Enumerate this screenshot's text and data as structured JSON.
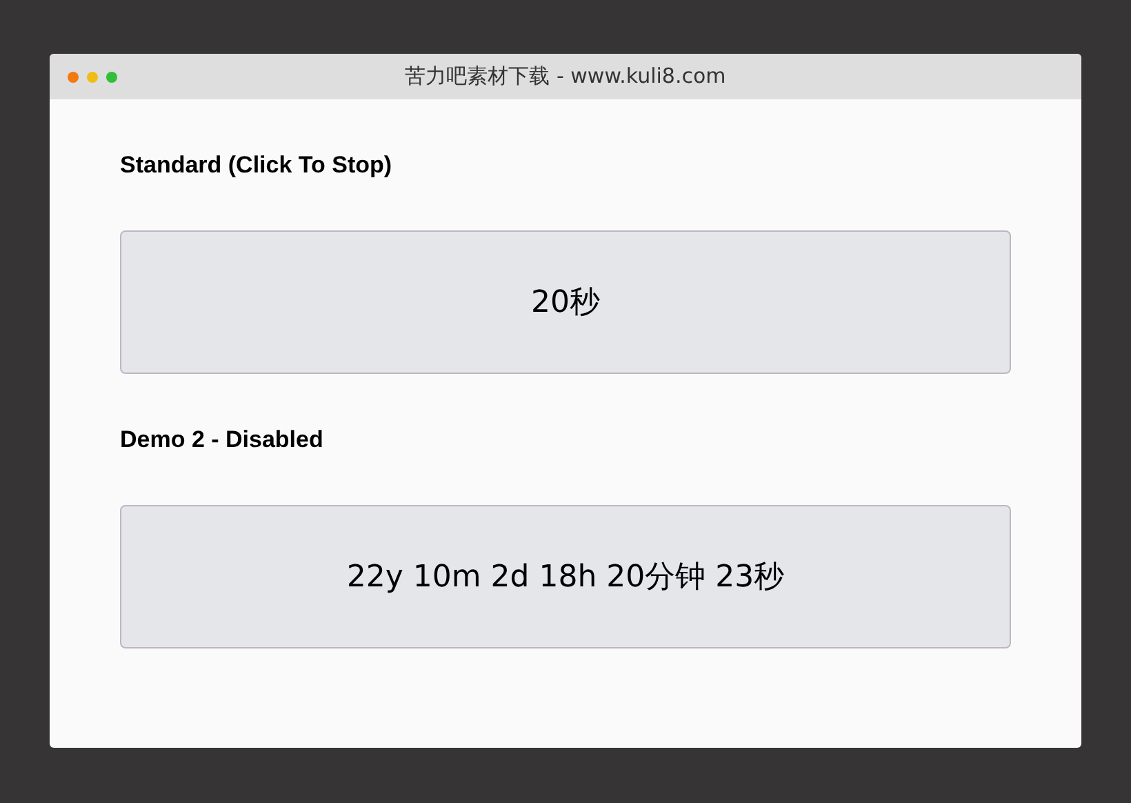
{
  "window": {
    "title": "苦力吧素材下载 - www.kuli8.com"
  },
  "demos": [
    {
      "heading": "Standard (Click To Stop)",
      "timer": "20秒"
    },
    {
      "heading": "Demo 2 - Disabled",
      "timer": "22y 10m 2d 18h 20分钟 23秒"
    }
  ]
}
